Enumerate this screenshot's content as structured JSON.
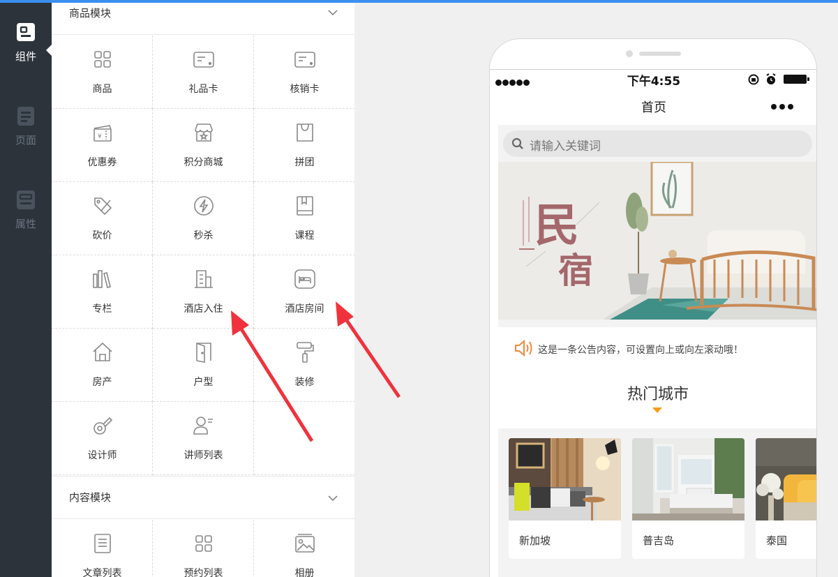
{
  "left_nav": {
    "items": [
      {
        "label": "组件",
        "icon": "component-icon",
        "active": true
      },
      {
        "label": "页面",
        "icon": "page-icon",
        "active": false
      },
      {
        "label": "属性",
        "icon": "property-icon",
        "active": false
      }
    ]
  },
  "panel": {
    "section1": {
      "title": "商品模块",
      "items": [
        {
          "label": "商品",
          "icon": "grid-icon"
        },
        {
          "label": "礼品卡",
          "icon": "gift-card-icon"
        },
        {
          "label": "核销卡",
          "icon": "verify-card-icon"
        },
        {
          "label": "优惠券",
          "icon": "coupon-icon"
        },
        {
          "label": "积分商城",
          "icon": "points-store-icon"
        },
        {
          "label": "拼团",
          "icon": "group-buy-icon"
        },
        {
          "label": "砍价",
          "icon": "bargain-icon"
        },
        {
          "label": "秒杀",
          "icon": "flash-sale-icon"
        },
        {
          "label": "课程",
          "icon": "course-icon"
        },
        {
          "label": "专栏",
          "icon": "column-icon"
        },
        {
          "label": "酒店入住",
          "icon": "hotel-checkin-icon"
        },
        {
          "label": "酒店房间",
          "icon": "hotel-room-icon"
        },
        {
          "label": "房产",
          "icon": "house-icon"
        },
        {
          "label": "户型",
          "icon": "door-icon"
        },
        {
          "label": "装修",
          "icon": "paint-roller-icon"
        },
        {
          "label": "设计师",
          "icon": "designer-icon"
        },
        {
          "label": "讲师列表",
          "icon": "lecturer-icon"
        }
      ]
    },
    "section2": {
      "title": "内容模块",
      "items": [
        {
          "label": "文章列表",
          "icon": "article-icon"
        },
        {
          "label": "预约列表",
          "icon": "grid-icon"
        },
        {
          "label": "相册",
          "icon": "album-icon"
        }
      ]
    }
  },
  "phone": {
    "status": {
      "time": "下午4:55"
    },
    "nav_title": "首页",
    "search_placeholder": "请输入关键词",
    "banner": {
      "big_text_1": "民",
      "big_text_2": "宿"
    },
    "notice": "这是一条公告内容，可设置向上或向左滚动哦！",
    "hot_title": "热门城市",
    "cities": [
      {
        "name": "新加坡"
      },
      {
        "name": "普吉岛"
      },
      {
        "name": "泰国"
      }
    ]
  },
  "colors": {
    "accent_blue": "#3b8ff0",
    "nav_dark": "#2c333b",
    "arrow_red": "#f0323c",
    "notice_orange": "#f0883a",
    "hot_orange": "#f49c1c"
  }
}
